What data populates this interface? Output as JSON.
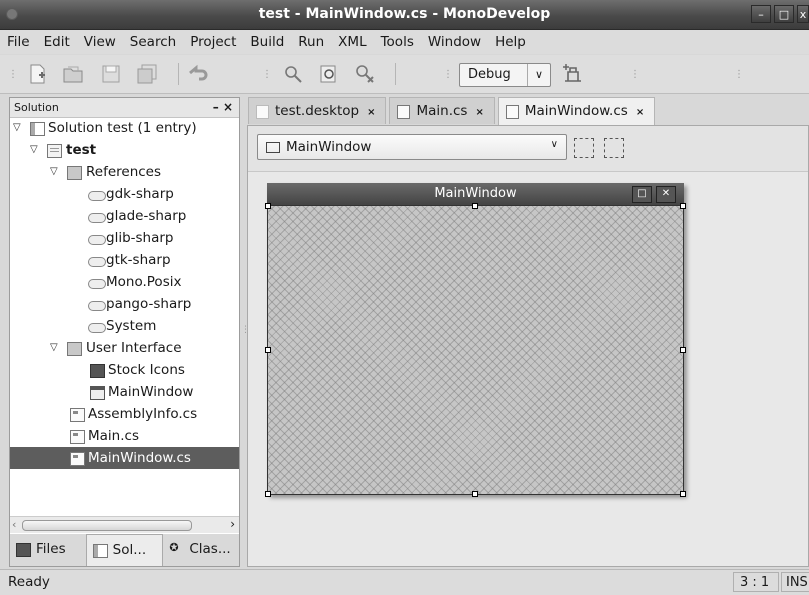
{
  "window": {
    "title": "test - MainWindow.cs - MonoDevelop"
  },
  "menu": [
    "File",
    "Edit",
    "View",
    "Search",
    "Project",
    "Build",
    "Run",
    "XML",
    "Tools",
    "Window",
    "Help"
  ],
  "toolbar": {
    "configuration": "Debug"
  },
  "solution_pad": {
    "title": "Solution",
    "close": "×",
    "tree": [
      {
        "label": "Solution test (1 entry)"
      },
      {
        "label": "test"
      },
      {
        "label": "References"
      },
      {
        "label": "gdk-sharp"
      },
      {
        "label": "glade-sharp"
      },
      {
        "label": "glib-sharp"
      },
      {
        "label": "gtk-sharp"
      },
      {
        "label": "Mono.Posix"
      },
      {
        "label": "pango-sharp"
      },
      {
        "label": "System"
      },
      {
        "label": "User Interface"
      },
      {
        "label": "Stock Icons"
      },
      {
        "label": "MainWindow"
      },
      {
        "label": "AssemblyInfo.cs"
      },
      {
        "label": "Main.cs"
      },
      {
        "label": "MainWindow.cs"
      }
    ],
    "tabs": [
      "Files",
      "Sol...",
      "Clas..."
    ]
  },
  "doc_tabs": [
    {
      "label": "test.desktop"
    },
    {
      "label": "Main.cs"
    },
    {
      "label": "MainWindow.cs"
    }
  ],
  "designer": {
    "widget_combo": "MainWindow",
    "window_title": "MainWindow"
  },
  "status": {
    "message": "Ready",
    "position": "3 : 1",
    "mode": "INS"
  }
}
